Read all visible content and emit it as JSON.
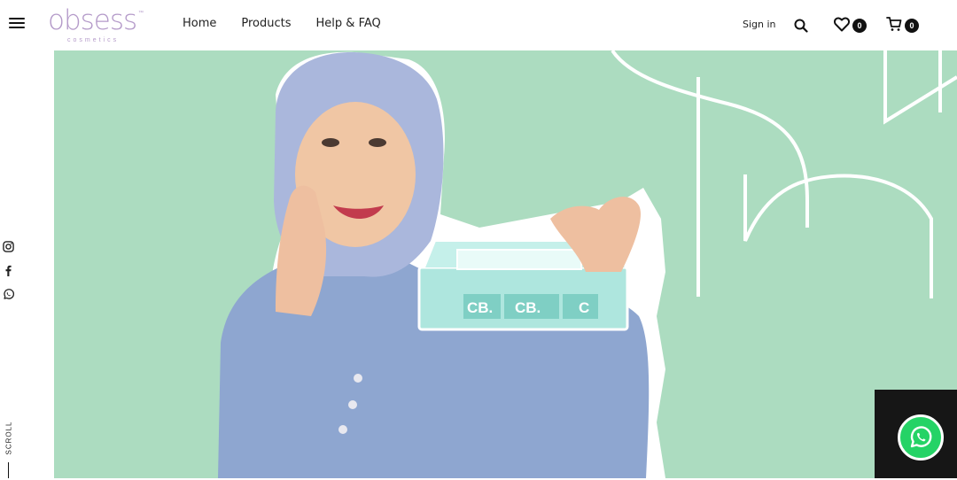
{
  "brand": {
    "logo_text": "obsess",
    "logo_tm": "™",
    "logo_subtext": "cosmetics",
    "brand_color": "#b49ac9"
  },
  "nav": {
    "items": [
      {
        "label": "Home"
      },
      {
        "label": "Products"
      },
      {
        "label": "Help & FAQ"
      }
    ]
  },
  "header_actions": {
    "sign_in_label": "Sign in",
    "wishlist_count": "0",
    "cart_count": "0",
    "icons": [
      "menu-icon",
      "search-icon",
      "heart-icon",
      "cart-icon"
    ]
  },
  "side_rail": {
    "social_icons": [
      "instagram-icon",
      "facebook-icon",
      "whatsapp-icon"
    ],
    "scroll_label": "SCROLL"
  },
  "hero": {
    "background_color": "#acdcc0",
    "product_box_text": [
      "CB.",
      "CB.",
      "C"
    ]
  },
  "chat_widget": {
    "icon": "whatsapp-icon",
    "color": "#25d366"
  }
}
